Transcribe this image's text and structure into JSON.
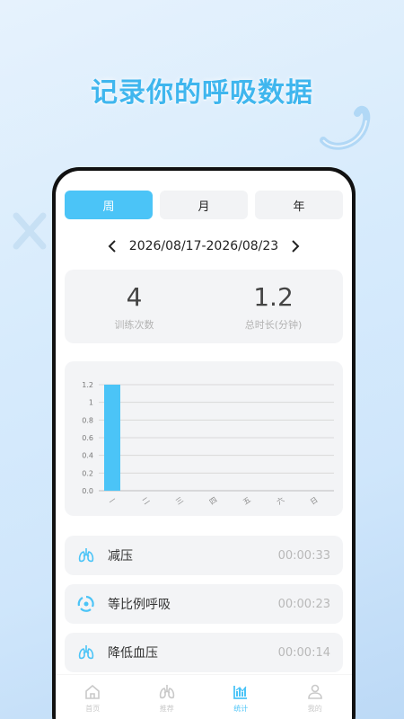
{
  "headline": "记录你的呼吸数据",
  "tabs": [
    {
      "label": "周",
      "active": true
    },
    {
      "label": "月",
      "active": false
    },
    {
      "label": "年",
      "active": false
    }
  ],
  "date_range": "2026/08/17-2026/08/23",
  "summary": {
    "count_value": "4",
    "count_label": "训练次数",
    "duration_value": "1.2",
    "duration_label": "总时长(分钟)"
  },
  "chart_data": {
    "type": "bar",
    "categories": [
      "一",
      "二",
      "三",
      "四",
      "五",
      "六",
      "日"
    ],
    "values": [
      1.2,
      0,
      0,
      0,
      0,
      0,
      0
    ],
    "ylim": [
      0,
      1.2
    ],
    "yticks": [
      "0.0",
      "0.2",
      "0.4",
      "0.6",
      "0.8",
      "1",
      "1.2"
    ],
    "grid": true,
    "bar_color": "#4bc4f7"
  },
  "records": [
    {
      "name": "减压",
      "time": "00:00:33",
      "icon": "lungs-icon"
    },
    {
      "name": "等比例呼吸",
      "time": "00:00:23",
      "icon": "cycle-icon"
    },
    {
      "name": "降低血压",
      "time": "00:00:14",
      "icon": "lungs-icon"
    }
  ],
  "nav": [
    {
      "label": "首页",
      "icon": "home-icon",
      "active": false
    },
    {
      "label": "推荐",
      "icon": "lungs-icon",
      "active": false
    },
    {
      "label": "统计",
      "icon": "chart-icon",
      "active": true
    },
    {
      "label": "我的",
      "icon": "profile-icon",
      "active": false
    }
  ],
  "colors": {
    "accent": "#4bc4f7",
    "headline": "#3fb6ee"
  }
}
